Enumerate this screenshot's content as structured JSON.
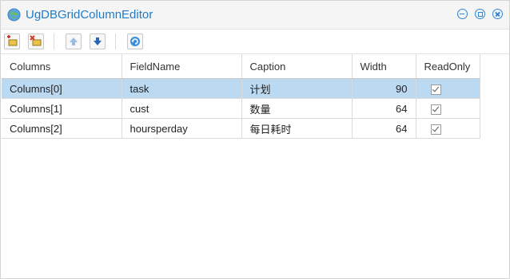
{
  "window": {
    "title": "UgDBGridColumnEditor"
  },
  "toolbar": {
    "buttons": [
      {
        "name": "add-column-icon"
      },
      {
        "name": "delete-column-icon"
      },
      {
        "name": "move-up-icon"
      },
      {
        "name": "move-down-icon"
      },
      {
        "name": "refresh-icon"
      }
    ]
  },
  "grid": {
    "headers": [
      "Columns",
      "FieldName",
      "Caption",
      "Width",
      "ReadOnly"
    ],
    "rows": [
      {
        "columns": "Columns[0]",
        "field": "task",
        "caption": "计划",
        "width": "90",
        "readonly": true,
        "selected": true
      },
      {
        "columns": "Columns[1]",
        "field": "cust",
        "caption": "数量",
        "width": "64",
        "readonly": true,
        "selected": false
      },
      {
        "columns": "Columns[2]",
        "field": "hoursperday",
        "caption": "每日耗时",
        "width": "64",
        "readonly": true,
        "selected": false
      }
    ]
  },
  "colors": {
    "accent": "#1e7bc9",
    "selection": "#bcd9f2"
  }
}
